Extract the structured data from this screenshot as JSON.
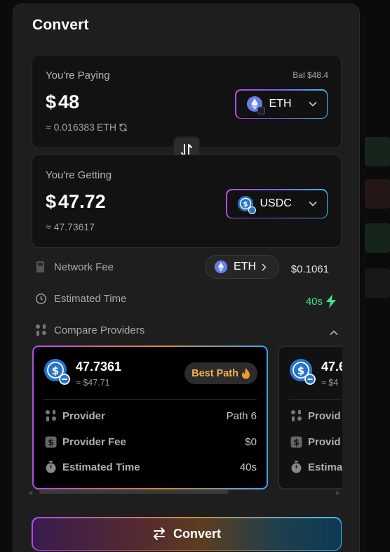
{
  "header": {
    "title": "Convert"
  },
  "paying": {
    "label": "You're Paying",
    "balance": "Bal $48.4",
    "currency_symbol": "$",
    "amount": "48",
    "sub_value": "≈ 0.016383",
    "sub_unit": "ETH",
    "token": "ETH",
    "token_icon": "eth-icon"
  },
  "getting": {
    "label": "You're Getting",
    "currency_symbol": "$",
    "amount": "47.72",
    "sub_value": "≈ 47.73617",
    "token": "USDC",
    "token_icon": "usdc-icon"
  },
  "network_fee": {
    "label": "Network Fee",
    "token": "ETH",
    "value": "$0.1061"
  },
  "estimated_time": {
    "label": "Estimated Time",
    "value": "40s"
  },
  "compare": {
    "label": "Compare Providers",
    "providers": [
      {
        "amount": "47.7361",
        "approx": "≈ $47.71",
        "badge": "Best Path",
        "rows": [
          {
            "label": "Provider",
            "value": "Path 6"
          },
          {
            "label": "Provider Fee",
            "value": "$0"
          },
          {
            "label": "Estimated Time",
            "value": "40s"
          }
        ]
      },
      {
        "amount": "47.6",
        "approx": "≈ $4",
        "rows": [
          {
            "label": "Provid"
          },
          {
            "label": "Provid"
          },
          {
            "label": "Estima"
          }
        ]
      }
    ]
  },
  "action": {
    "label": "Convert"
  },
  "colors": {
    "accent_green": "#3ee08a",
    "badge_orange": "#f3b24a",
    "gradient_purple": "#b44ce6",
    "gradient_blue": "#3fb7f5",
    "eth": "#627eea",
    "usdc": "#2775ca"
  }
}
